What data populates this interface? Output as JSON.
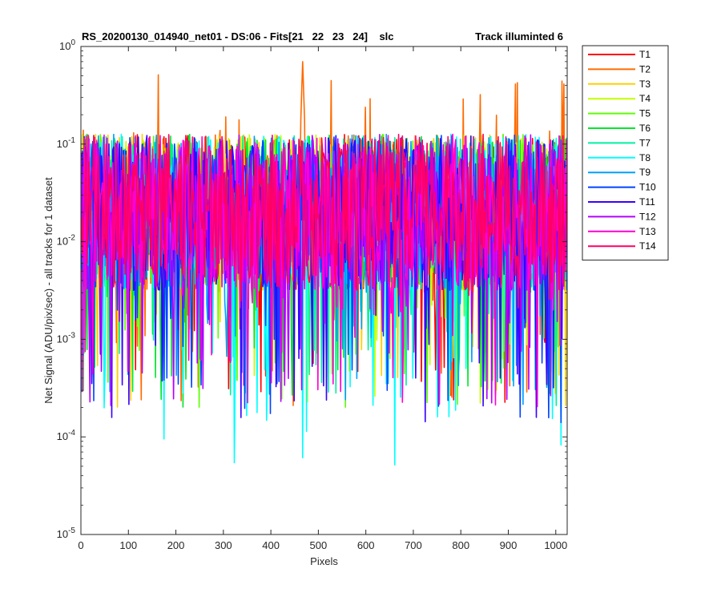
{
  "chart_data": {
    "type": "line",
    "title": "RS_20200130_014940_net01 - DS:06 - Fits[21   22   23   24]    slc",
    "title_right": "Track illuminted 6",
    "xlabel": "Pixels",
    "ylabel": "Net Signal (ADU/pix/sec) - all tracks for 1 dataset",
    "xlim": [
      0,
      1024
    ],
    "ylim": [
      1e-05,
      1
    ],
    "yscale": "log",
    "x_ticks": [
      0,
      100,
      200,
      300,
      400,
      500,
      600,
      700,
      800,
      900,
      1000
    ],
    "y_ticks": [
      {
        "base": "10",
        "exp": "0",
        "value": 1
      },
      {
        "base": "10",
        "exp": "-1",
        "value": 0.1
      },
      {
        "base": "10",
        "exp": "-2",
        "value": 0.01
      },
      {
        "base": "10",
        "exp": "-3",
        "value": 0.001
      },
      {
        "base": "10",
        "exp": "-4",
        "value": 0.0001
      },
      {
        "base": "10",
        "exp": "-5",
        "value": 1e-05
      }
    ],
    "grid": false,
    "legend_position": "outside-top-right",
    "series": [
      {
        "name": "T1",
        "color": "#ff0000",
        "typical_value": 0.02,
        "low_value": 0.0002,
        "peak_value": 0.1
      },
      {
        "name": "T2",
        "color": "#ff6a00",
        "typical_value": 0.02,
        "low_value": 0.0002,
        "peak_value": 0.7,
        "peak_x": 467
      },
      {
        "name": "T3",
        "color": "#ffd000",
        "typical_value": 0.02,
        "low_value": 0.0002,
        "peak_value": 0.1
      },
      {
        "name": "T4",
        "color": "#c2ff00",
        "typical_value": 0.02,
        "low_value": 0.0002,
        "peak_value": 0.11
      },
      {
        "name": "T5",
        "color": "#5cff00",
        "typical_value": 0.02,
        "low_value": 0.0002,
        "peak_value": 0.12
      },
      {
        "name": "T6",
        "color": "#00e62e",
        "typical_value": 0.02,
        "low_value": 0.0002,
        "peak_value": 0.11
      },
      {
        "name": "T7",
        "color": "#00f0a0",
        "typical_value": 0.02,
        "low_value": 0.0002,
        "peak_value": 0.1
      },
      {
        "name": "T8",
        "color": "#00ffff",
        "typical_value": 0.02,
        "low_value": 5e-05,
        "peak_value": 0.09
      },
      {
        "name": "T9",
        "color": "#00a0ff",
        "typical_value": 0.02,
        "low_value": 0.0002,
        "peak_value": 0.09
      },
      {
        "name": "T10",
        "color": "#0044ff",
        "typical_value": 0.02,
        "low_value": 0.00013,
        "peak_value": 0.09
      },
      {
        "name": "T11",
        "color": "#3a00ff",
        "typical_value": 0.02,
        "low_value": 0.00013,
        "peak_value": 0.09
      },
      {
        "name": "T12",
        "color": "#b400ff",
        "typical_value": 0.02,
        "low_value": 0.0002,
        "peak_value": 0.09
      },
      {
        "name": "T13",
        "color": "#ff00d0",
        "typical_value": 0.02,
        "low_value": 0.0002,
        "peak_value": 0.08
      },
      {
        "name": "T14",
        "color": "#ff0066",
        "typical_value": 0.02,
        "low_value": 0.002,
        "peak_value": 0.06
      }
    ]
  }
}
